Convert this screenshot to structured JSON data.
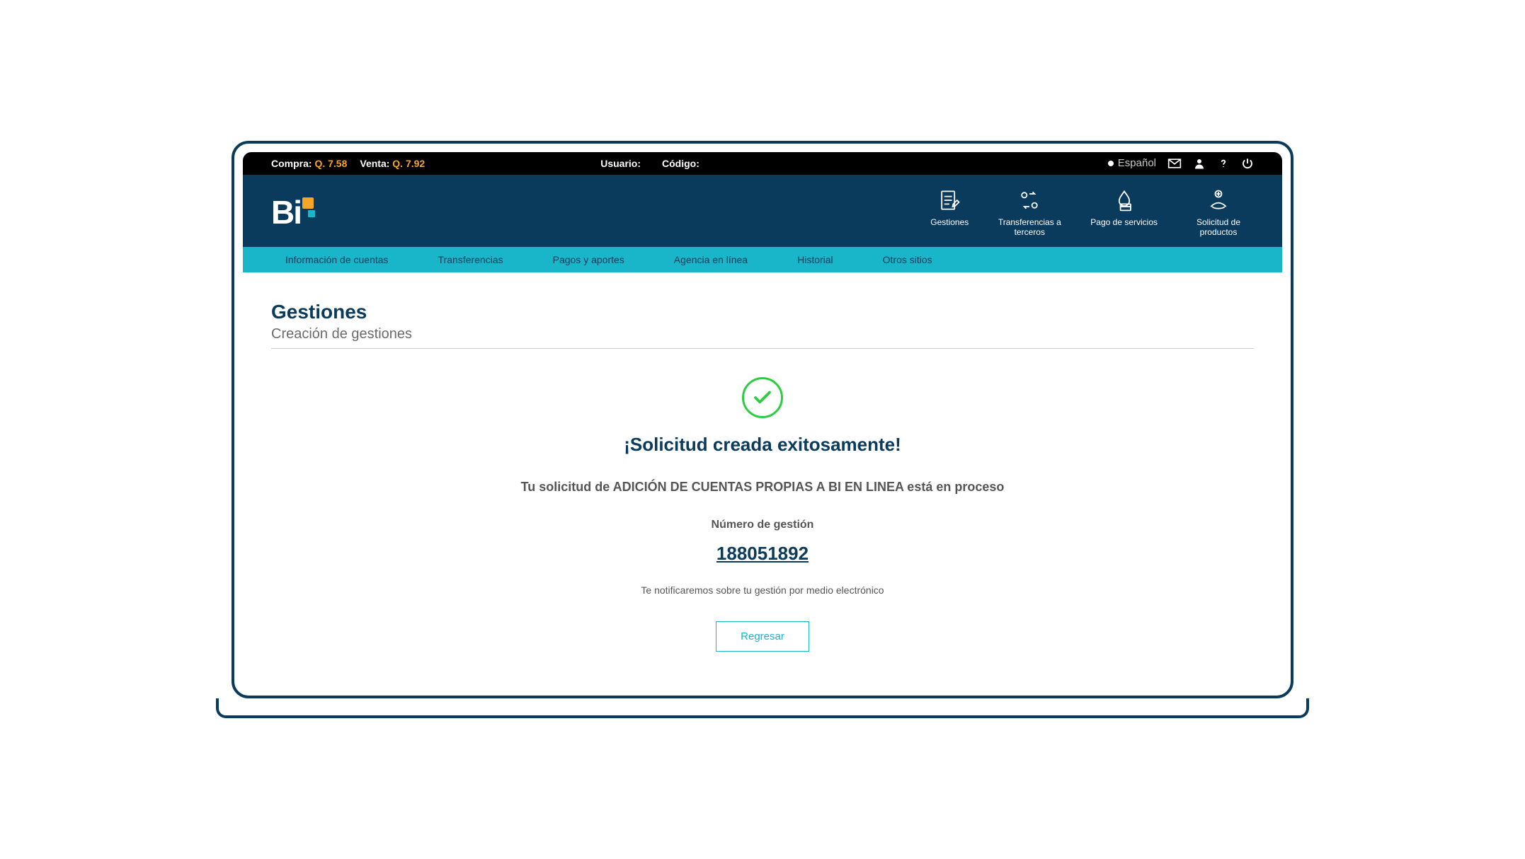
{
  "topbar": {
    "compra_label": "Compra:",
    "compra_value": "Q. 7.58",
    "venta_label": "Venta:",
    "venta_value": "Q. 7.92",
    "usuario_label": "Usuario:",
    "codigo_label": "Código:",
    "language": "Español"
  },
  "header_actions": [
    {
      "label": "Gestiones"
    },
    {
      "label": "Transferencias a terceros"
    },
    {
      "label": "Pago de servicios"
    },
    {
      "label": "Solicitud de productos"
    }
  ],
  "nav": [
    "Información de cuentas",
    "Transferencias",
    "Pagos y aportes",
    "Agencia en línea",
    "Historial",
    "Otros sitios"
  ],
  "page": {
    "title": "Gestiones",
    "subtitle": "Creación de gestiones"
  },
  "success": {
    "title": "¡Solicitud creada exitosamente!",
    "message": "Tu solicitud de ADICIÓN DE CUENTAS PROPIAS A BI EN LINEA está en proceso",
    "gestion_label": "Número de gestión",
    "gestion_number": "188051892",
    "notify": "Te notificaremos sobre tu gestión por medio electrónico",
    "back_button": "Regresar"
  }
}
